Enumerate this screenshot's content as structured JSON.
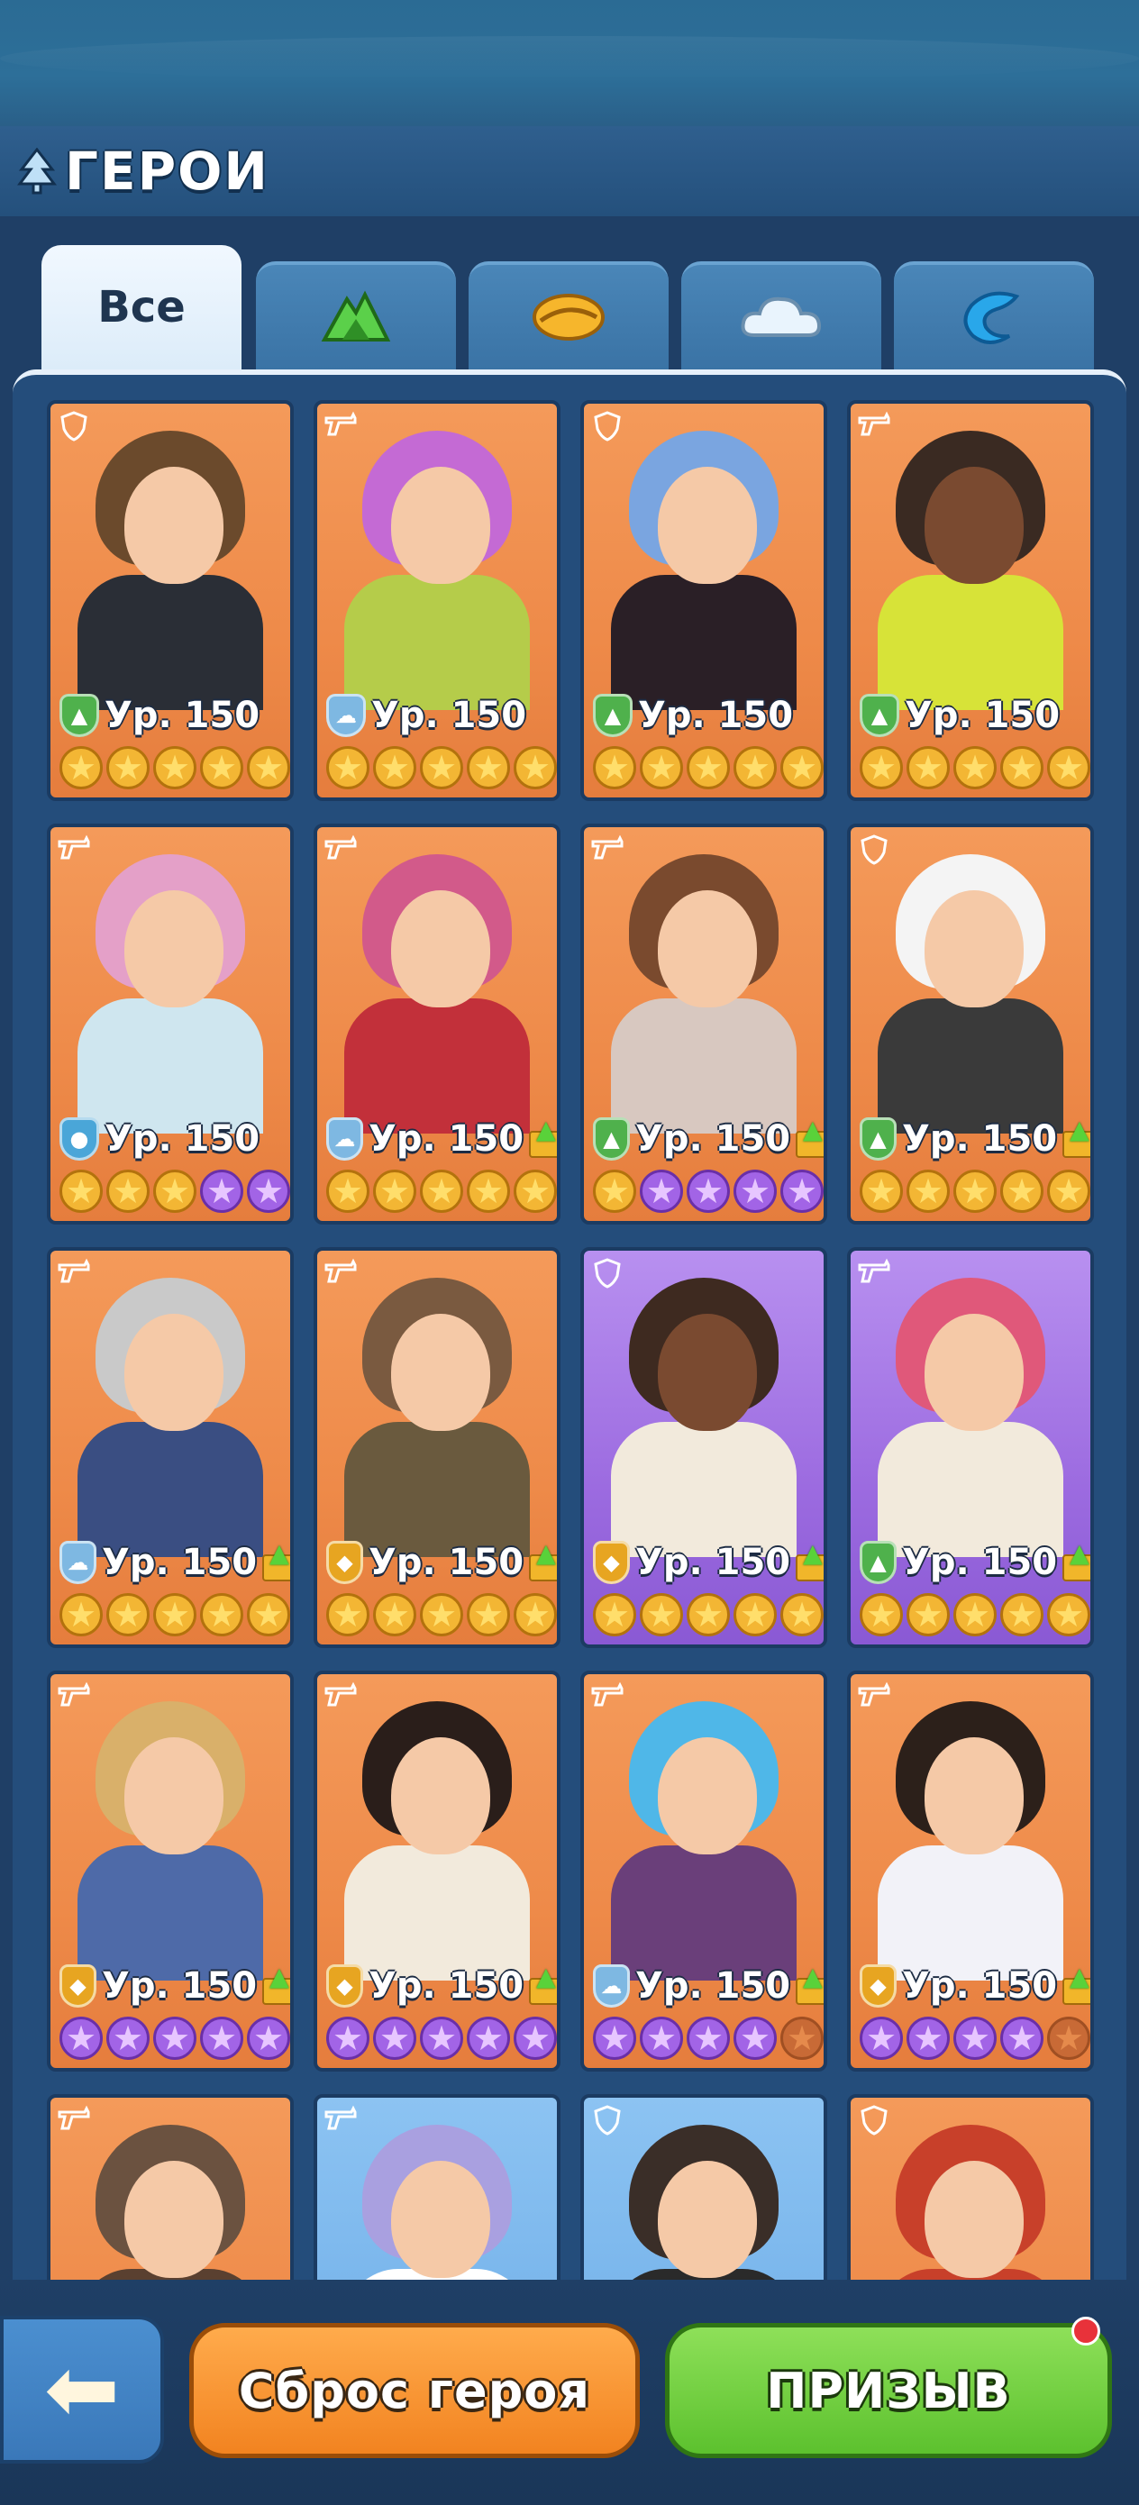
{
  "header": {
    "title": "ГЕРОИ",
    "icon": "tree-icon"
  },
  "tabs": [
    {
      "label": "Все",
      "icon": "",
      "active": true
    },
    {
      "label": "",
      "icon": "forest-icon",
      "active": false
    },
    {
      "label": "",
      "icon": "sand-icon",
      "active": false
    },
    {
      "label": "",
      "icon": "cloud-icon",
      "active": false
    },
    {
      "label": "",
      "icon": "water-icon",
      "active": false
    }
  ],
  "heroes": [
    {
      "bg": "orange",
      "role": "shield-icon",
      "faction": "forest",
      "level": "Ур. 150",
      "upgrade": false,
      "stars": [
        "gold",
        "gold",
        "gold",
        "gold",
        "gold"
      ]
    },
    {
      "bg": "orange",
      "role": "gun-icon",
      "faction": "cloud",
      "level": "Ур. 150",
      "upgrade": false,
      "stars": [
        "gold",
        "gold",
        "gold",
        "gold",
        "gold"
      ]
    },
    {
      "bg": "orange",
      "role": "shield-icon",
      "faction": "forest",
      "level": "Ур. 150",
      "upgrade": false,
      "stars": [
        "gold",
        "gold",
        "gold",
        "gold",
        "gold"
      ]
    },
    {
      "bg": "orange",
      "role": "gun-icon",
      "faction": "forest",
      "level": "Ур. 150",
      "upgrade": false,
      "stars": [
        "gold",
        "gold",
        "gold",
        "gold",
        "gold"
      ]
    },
    {
      "bg": "orange",
      "role": "gun-icon",
      "faction": "water",
      "level": "Ур. 150",
      "upgrade": false,
      "stars": [
        "gold",
        "gold",
        "gold",
        "purple",
        "purple"
      ]
    },
    {
      "bg": "orange",
      "role": "gun-icon",
      "faction": "cloud",
      "level": "Ур. 150",
      "upgrade": true,
      "stars": [
        "gold",
        "gold",
        "gold",
        "gold",
        "gold"
      ]
    },
    {
      "bg": "orange",
      "role": "gun-icon",
      "faction": "forest",
      "level": "Ур. 150",
      "upgrade": true,
      "stars": [
        "gold",
        "purple",
        "purple",
        "purple",
        "purple"
      ]
    },
    {
      "bg": "orange",
      "role": "shield-icon",
      "faction": "forest",
      "level": "Ур. 150",
      "upgrade": true,
      "stars": [
        "gold",
        "gold",
        "gold",
        "gold",
        "gold"
      ]
    },
    {
      "bg": "orange",
      "role": "gun-icon",
      "faction": "cloud",
      "level": "Ур. 150",
      "upgrade": true,
      "stars": [
        "gold",
        "gold",
        "gold",
        "gold",
        "gold"
      ]
    },
    {
      "bg": "orange",
      "role": "gun-icon",
      "faction": "sand",
      "level": "Ур. 150",
      "upgrade": true,
      "stars": [
        "gold",
        "gold",
        "gold",
        "gold",
        "gold"
      ]
    },
    {
      "bg": "purple",
      "role": "shield-icon",
      "faction": "sand",
      "level": "Ур. 150",
      "upgrade": true,
      "stars": [
        "gold",
        "gold",
        "gold",
        "gold",
        "gold"
      ]
    },
    {
      "bg": "purple",
      "role": "gun-icon",
      "faction": "forest",
      "level": "Ур. 150",
      "upgrade": true,
      "stars": [
        "gold",
        "gold",
        "gold",
        "gold",
        "gold"
      ]
    },
    {
      "bg": "orange",
      "role": "gun-icon",
      "faction": "sand",
      "level": "Ур. 150",
      "upgrade": true,
      "stars": [
        "purple",
        "purple",
        "purple",
        "purple",
        "purple"
      ]
    },
    {
      "bg": "orange",
      "role": "gun-icon",
      "faction": "sand",
      "level": "Ур. 150",
      "upgrade": true,
      "stars": [
        "purple",
        "purple",
        "purple",
        "purple",
        "purple"
      ]
    },
    {
      "bg": "orange",
      "role": "gun-icon",
      "faction": "cloud",
      "level": "Ур. 150",
      "upgrade": true,
      "stars": [
        "purple",
        "purple",
        "purple",
        "purple",
        "empty"
      ]
    },
    {
      "bg": "orange",
      "role": "gun-icon",
      "faction": "sand",
      "level": "Ур. 150",
      "upgrade": true,
      "stars": [
        "purple",
        "purple",
        "purple",
        "purple",
        "empty"
      ]
    },
    {
      "bg": "orange",
      "role": "gun-icon",
      "faction": "",
      "level": "",
      "upgrade": false,
      "stars": []
    },
    {
      "bg": "blue",
      "role": "gun-icon",
      "faction": "",
      "level": "",
      "upgrade": false,
      "stars": []
    },
    {
      "bg": "blue",
      "role": "shield-icon",
      "faction": "",
      "level": "",
      "upgrade": false,
      "stars": []
    },
    {
      "bg": "orange",
      "role": "shield-icon",
      "faction": "",
      "level": "",
      "upgrade": false,
      "stars": []
    }
  ],
  "bottom": {
    "back_icon": "back-arrow-icon",
    "reset_label": "Сброс героя",
    "summon_label": "ПРИЗЫВ",
    "summon_notification": true
  },
  "colors": {
    "background": "#1f3f66",
    "card_orange": "#ee8a49",
    "card_purple": "#9c6be0",
    "card_blue": "#68a9e6",
    "reset_button": "#f28320",
    "summon_button": "#5cc12e",
    "notification": "#e8323a"
  }
}
